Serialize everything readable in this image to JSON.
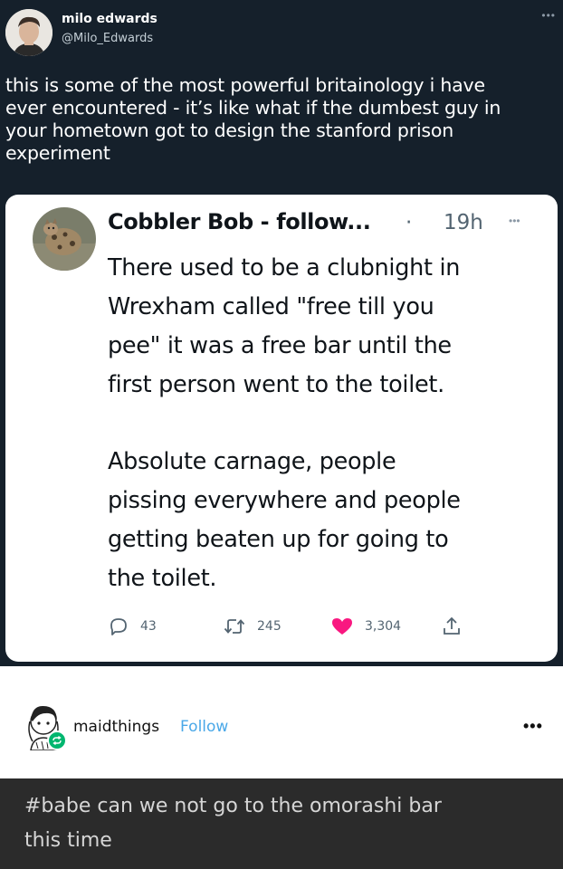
{
  "tweet": {
    "author_name": "milo edwards",
    "author_handle": "@Milo_Edwards",
    "more_icon": "ellipsis-icon",
    "text_lines": [
      "this is some of the most powerful britainology i have",
      "ever encountered - it’s like what if the dumbest guy in",
      "your hometown got to design the stanford prison",
      "experiment"
    ]
  },
  "quote": {
    "author_name": "Cobbler Bob - follow...",
    "separator": "·",
    "time": "19h",
    "body_paragraph_1": [
      "There used to be a clubnight in",
      "Wrexham called \"free till you",
      "pee\" it was a free bar until the",
      "first person went to the toilet."
    ],
    "body_paragraph_2": [
      "Absolute carnage, people",
      "pissing everywhere and people",
      "getting beaten up for going to",
      "the toilet."
    ],
    "replies": "43",
    "retweets": "245",
    "likes": "3,304",
    "like_color": "#f91880",
    "icons": [
      "reply-icon",
      "retweet-icon",
      "heart-icon",
      "share-icon"
    ]
  },
  "reblog": {
    "username": "maidthings",
    "follow_label": "Follow",
    "follow_color": "#4aa8e8",
    "badge_color": "#00b66f",
    "tags_text_lines": [
      "#babe can we not go to the omorashi bar",
      "this time"
    ]
  }
}
